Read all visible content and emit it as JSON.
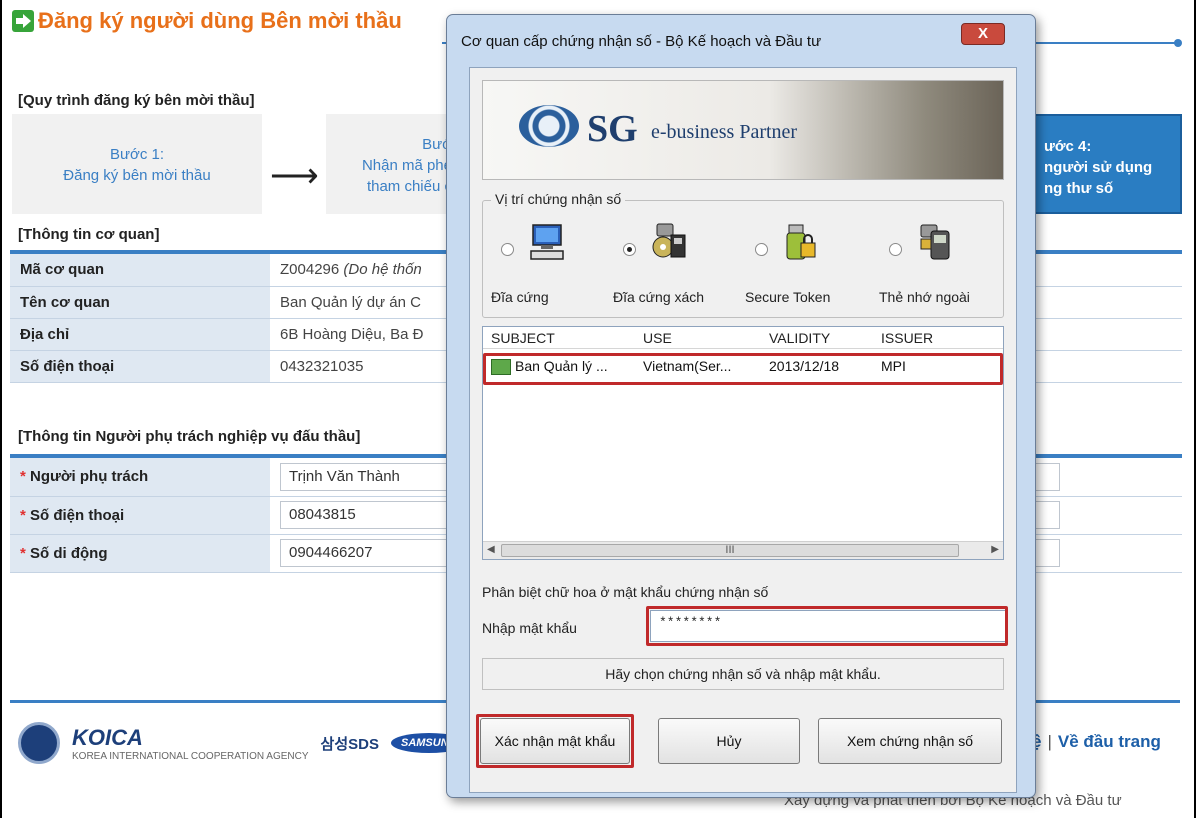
{
  "page": {
    "title": "Đăng ký người dùng Bên mời thầu",
    "process_label": "[Quy trình đăng ký bên mời thầu]",
    "steps": [
      {
        "line1": "Bước 1:",
        "line2": "Đăng ký bên mời thầu"
      },
      {
        "line1": "Bướ",
        "line2": "Nhận mã phé",
        "line3": "tham chiếu c"
      },
      {
        "line1": "ước 4:",
        "line2": "người sử dụng",
        "line3": "ng thư số"
      }
    ],
    "org_label": "[Thông tin cơ quan]",
    "org_rows": [
      {
        "label": "Mã cơ quan",
        "value": "Z004296 ",
        "note": "(Do hệ thốn"
      },
      {
        "label": "Tên cơ quan",
        "value": "Ban Quản lý dự án C"
      },
      {
        "label": "Địa chỉ",
        "value": "6B Hoàng Diệu, Ba Đ"
      },
      {
        "label": "Số điện thoại",
        "value": "0432321035"
      }
    ],
    "person_label": "[Thông tin Người phụ trách nghiệp vụ đấu thầu]",
    "person_rows": [
      {
        "label": "Người phụ trách",
        "value": "Trịnh Văn Thành"
      },
      {
        "label": "Số điện thoại",
        "value": "08043815"
      },
      {
        "label": "Số di động",
        "value": "0904466207"
      }
    ],
    "required_mark": "* ",
    "partners": {
      "koica": "KOICA",
      "koica_sub": "KOREA INTERNATIONAL COOPERATION AGENCY",
      "sds": "삼성SDS",
      "samsung": "SAMSUNG"
    },
    "footer_links": [
      "ệ",
      "Về đầu trang"
    ],
    "footer_sep": "|",
    "footer_text": "Xây dựng và phát triển bởi Bộ Kế hoạch và Đầu tư"
  },
  "dialog": {
    "title": "Cơ quan cấp chứng nhận số - Bộ Kế hoạch và Đầu tư",
    "close_label": "X",
    "banner": {
      "brand": "SG",
      "tagline": "e-business Partner"
    },
    "location_legend": "Vị trí chứng nhận số",
    "locations": [
      {
        "label": "Đĩa cứng",
        "selected": false,
        "icon": "computer-icon"
      },
      {
        "label": "Đĩa cứng xách",
        "selected": true,
        "icon": "usb-disk-icon"
      },
      {
        "label": "Secure Token",
        "selected": false,
        "icon": "secure-token-icon"
      },
      {
        "label": "Thẻ nhớ ngoài",
        "selected": false,
        "icon": "memory-card-icon"
      }
    ],
    "columns": [
      "SUBJECT",
      "USE",
      "VALIDITY",
      "ISSUER"
    ],
    "certificates": [
      {
        "subject": "Ban Quản lý ...",
        "use": "Vietnam(Ser...",
        "validity": "2013/12/18",
        "issuer": "MPI"
      }
    ],
    "case_note": "Phân biệt chữ hoa ở mật khẩu chứng nhận số",
    "password_label": "Nhập mật khẩu",
    "password_value": "********",
    "status": "Hãy chọn chứng nhận số và nhập mật khẩu.",
    "buttons": {
      "confirm": "Xác nhận mật khẩu",
      "cancel": "Hủy",
      "view": "Xem chứng nhận số"
    },
    "scroll_grip": "III",
    "highlight_color": "#c0292a"
  }
}
